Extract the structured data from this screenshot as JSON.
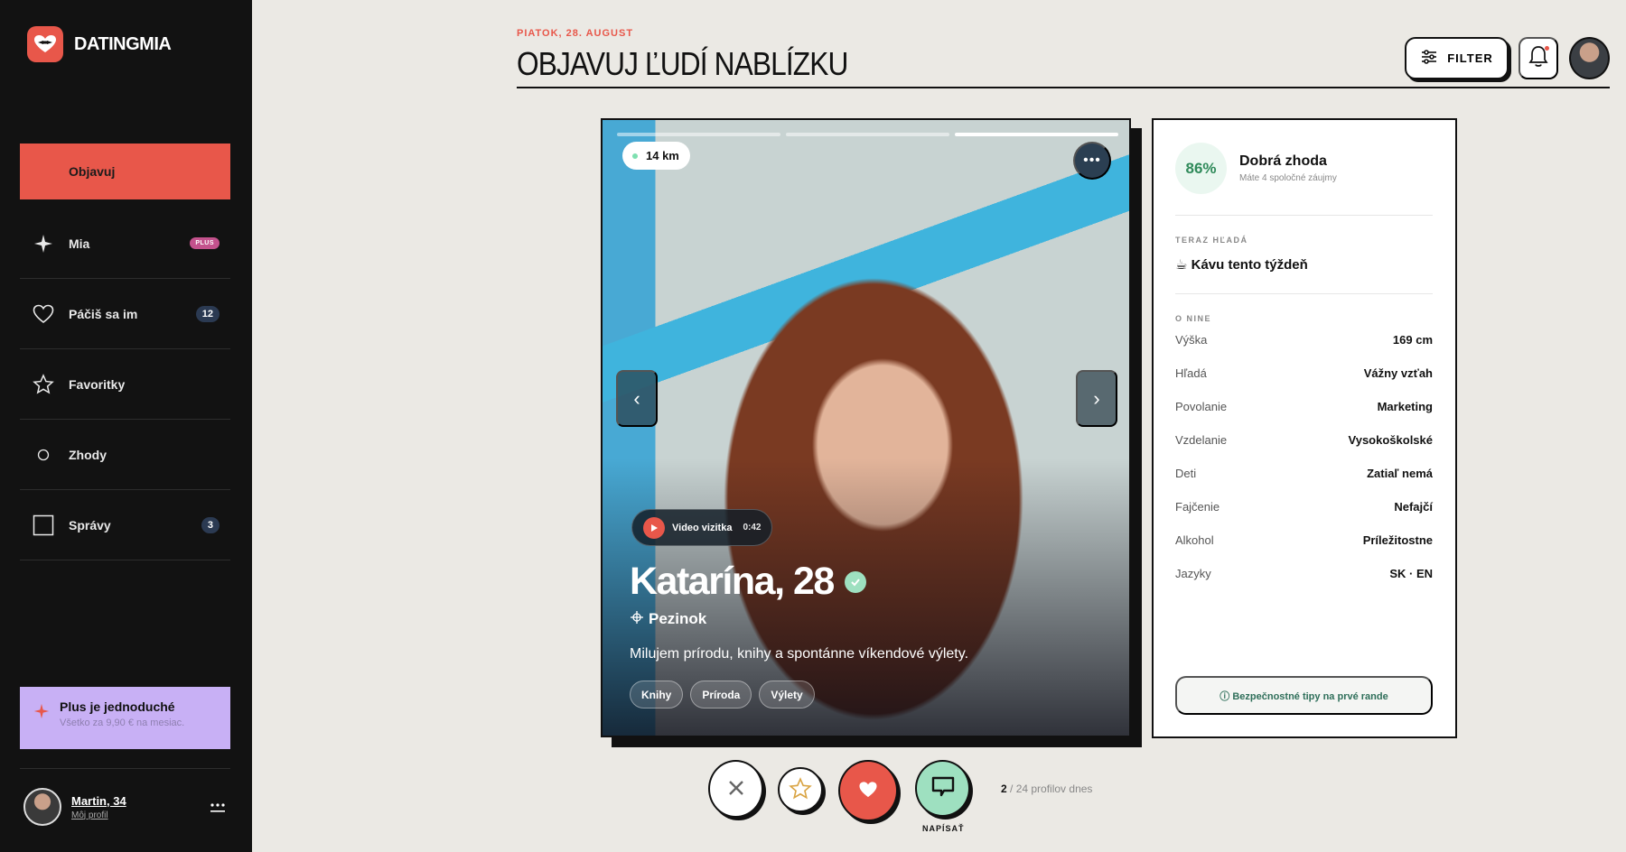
{
  "app": {
    "name": "DATINGMIA"
  },
  "sidebar": {
    "items": [
      {
        "label": "Objavuj",
        "icon": "compass-icon",
        "active": true
      },
      {
        "label": "Mia",
        "icon": "sparkle-icon",
        "badge": "PLUS"
      },
      {
        "label": "Páčiš sa im",
        "icon": "heart-icon",
        "badge": "12"
      },
      {
        "label": "Favoritky",
        "icon": "star-icon"
      },
      {
        "label": "Zhody",
        "icon": "circle-icon"
      },
      {
        "label": "Správy",
        "icon": "square-icon",
        "badge": "3"
      }
    ],
    "plus_card": {
      "title": "Plus je jednoduché",
      "subtitle": "Všetko za 9,90 € na mesiac."
    },
    "user": {
      "name": "Martin, 34",
      "link": "Môj profil"
    }
  },
  "header": {
    "date": "PIATOK, 28. AUGUST",
    "title": "OBJAVUJ ĽUDÍ NABLÍZKU",
    "filter_label": "FILTER"
  },
  "profile": {
    "distance": "14 km",
    "video_label": "Video vizitka",
    "video_time": "0:42",
    "name_age": "Katarína, 28",
    "city": "Pezinok",
    "bio": "Milujem prírodu, knihy a spontánne víkendové výlety.",
    "tags": [
      "Knihy",
      "Príroda",
      "Výlety"
    ],
    "photo_index": 3,
    "photo_count": 3
  },
  "actions": {
    "message_label": "NAPÍSAŤ",
    "counter_current": "2",
    "counter_rest": " / 24 profilov dnes"
  },
  "details": {
    "match_percent": "86%",
    "match_title": "Dobrá zhoda",
    "match_sub": "Máte 4 spoločné záujmy",
    "seeking_label": "TERAZ HĽADÁ",
    "seeking_value": "☕ Kávu tento týždeň",
    "about_label": "O NINE",
    "facts": [
      {
        "k": "Výška",
        "v": "169 cm"
      },
      {
        "k": "Hľadá",
        "v": "Vážny vzťah"
      },
      {
        "k": "Povolanie",
        "v": "Marketing"
      },
      {
        "k": "Vzdelanie",
        "v": "Vysokoškolské"
      },
      {
        "k": "Deti",
        "v": "Zatiaľ nemá"
      },
      {
        "k": "Fajčenie",
        "v": "Nefajčí"
      },
      {
        "k": "Alkohol",
        "v": "Príležitostne"
      },
      {
        "k": "Jazyky",
        "v": "SK · EN"
      }
    ],
    "safety": "ⓘ Bezpečnostné tipy na prvé rande"
  },
  "colors": {
    "accent": "#e8574a",
    "mint": "#9ee0c0",
    "plus": "#c8b0f5",
    "sidebar": "#121212"
  }
}
